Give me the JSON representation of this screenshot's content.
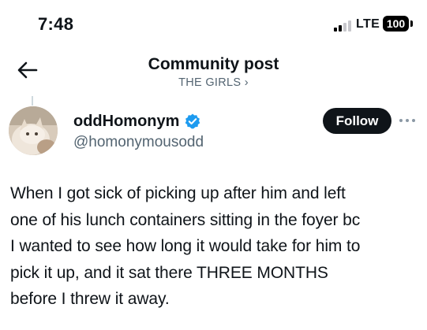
{
  "status_bar": {
    "time": "7:48",
    "network": "LTE",
    "battery": "100"
  },
  "header": {
    "title": "Community post",
    "community": "THE GIRLS",
    "community_chevron": "›"
  },
  "post": {
    "author": {
      "display_name": "oddHomonym",
      "handle": "@homonymousodd",
      "verified_color": "#1d9bf0"
    },
    "follow_label": "Follow",
    "text_lines": [
      "When I got sick of picking up after him and left",
      "one of his lunch containers sitting in the foyer bc",
      "I wanted to see how long it would take for him to",
      "pick it up, and it sat there THREE MONTHS",
      "before I threw it away."
    ]
  },
  "icons": {
    "back": "arrow-left-icon",
    "more": "more-icon",
    "verified": "verified-badge-icon"
  }
}
